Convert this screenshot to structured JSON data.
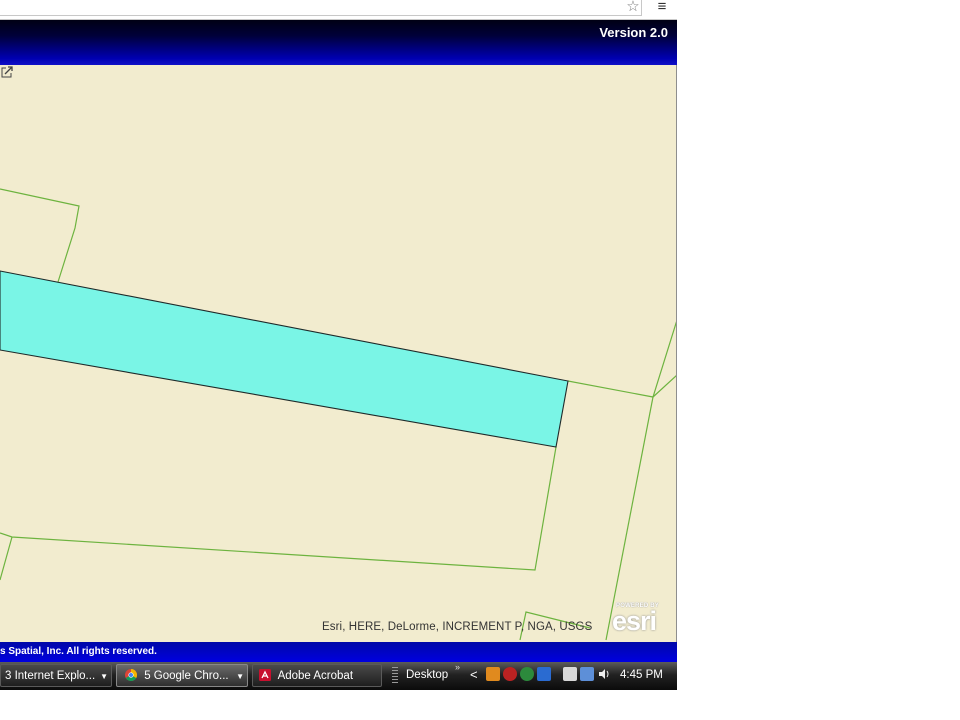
{
  "browser": {
    "star_icon": "star-icon",
    "menu_icon": "hamburger-menu-icon"
  },
  "header": {
    "version": "Version 2.0",
    "color": "#00009a"
  },
  "map": {
    "background_color": "#f2eccf",
    "selected_parcel_color": "#7af5e6",
    "parcel_line_color": "#6db33f",
    "attribution": "Esri, HERE, DeLorme, INCREMENT P, NGA, USGS",
    "logo_powered": "POWERED BY",
    "logo_text": "esri",
    "expand_icon": "expand-icon"
  },
  "footer": {
    "copyright": "s Spatial, Inc. All rights reserved."
  },
  "taskbar": {
    "buttons": [
      {
        "label": "3 Internet Explo...",
        "icon": "internet-explorer-icon"
      },
      {
        "label": "5 Google Chro...",
        "icon": "chrome-icon"
      },
      {
        "label": "Adobe Acrobat",
        "icon": "acrobat-icon"
      }
    ],
    "desktop_label": "Desktop",
    "chevron": "»",
    "tray_arrow": "<",
    "clock": "4:45 PM"
  }
}
